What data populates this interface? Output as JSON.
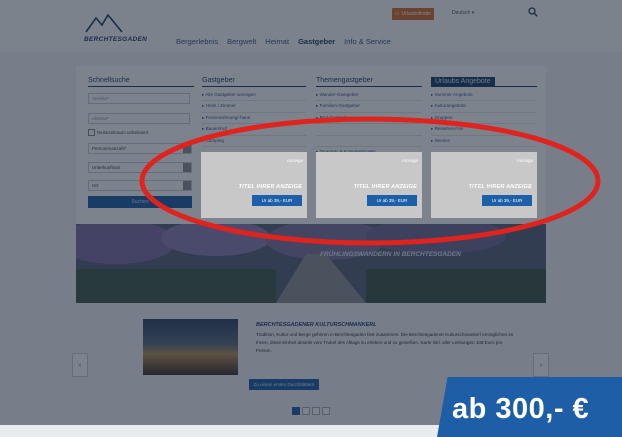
{
  "header": {
    "brand": "BERCHTESGADEN",
    "nav": [
      "Bergerlebnis",
      "Bergwelt",
      "Heimat",
      "Gastgeber",
      "Info & Service"
    ],
    "nav_active": "Gastgeber",
    "top_button": "Urlaubsfinder",
    "language": "Deutsch ▾"
  },
  "quicksearch": {
    "title": "Schnellsuche",
    "field1_placeholder": "Anreise*",
    "field2_placeholder": "Abreise*",
    "checkbox_label": "Reisezeitraum unbekannt",
    "select1": "Personenanzahl*",
    "select2": "Unterkunftsart",
    "select3": "Ort",
    "button": "Suchen"
  },
  "columns": [
    {
      "title": "Gastgeber",
      "items": [
        "Alle Gastgeber anzeigen",
        "Hotel / Zimmer",
        "Ferienwohnung/-haus",
        "Bauernhof",
        "Camping"
      ]
    },
    {
      "title": "Themengastgeber",
      "items": [
        "Wander-Gastgeber",
        "Familien-Gastgeber",
        "Rad-Gastgeber",
        "",
        "",
        "Tagungs- & Kongresshotels"
      ]
    },
    {
      "title": "Urlaubs Angebote",
      "items": [
        "Sommer Angebote",
        "Kulturangebote",
        "Gruppen",
        "Reisebus-Fan",
        "Service"
      ]
    }
  ],
  "ads": [
    {
      "tag": "Anzeige",
      "title": "TITEL IHRER ANZEIGE",
      "price": "Ur ab 39,- EUR"
    },
    {
      "tag": "Anzeige",
      "title": "TITEL IHRER ANZEIGE",
      "price": "Ur ab 39,- EUR"
    },
    {
      "tag": "Anzeige",
      "title": "TITEL IHRER ANZEIGE",
      "price": "Ur ab 39,- EUR"
    }
  ],
  "hero_caption": "FRÜHLINGSWANDERN IN BERCHTESGADEN",
  "teaser": {
    "title": "BERCHTESGADENER KULTURSCHMANKERL",
    "text": "Tradition, Kultur und Berge gehören in Berchtesgaden fest zusammen. Die Berchtesgadener Kulturschmankerl ermöglichen es Ihnen, diese Einheit abseits vom Trubel des Alltags zu erleben und zu genießen. Karte inkl. aller Leistungen 108 Euro pro Person.",
    "button": "Zu einem ersten Durchblättern"
  },
  "price_banner": "ab 300,- €",
  "colors": {
    "highlight_ring": "#e0231c",
    "brand_blue": "#1d5fa8",
    "navy": "#1b3d6a"
  }
}
